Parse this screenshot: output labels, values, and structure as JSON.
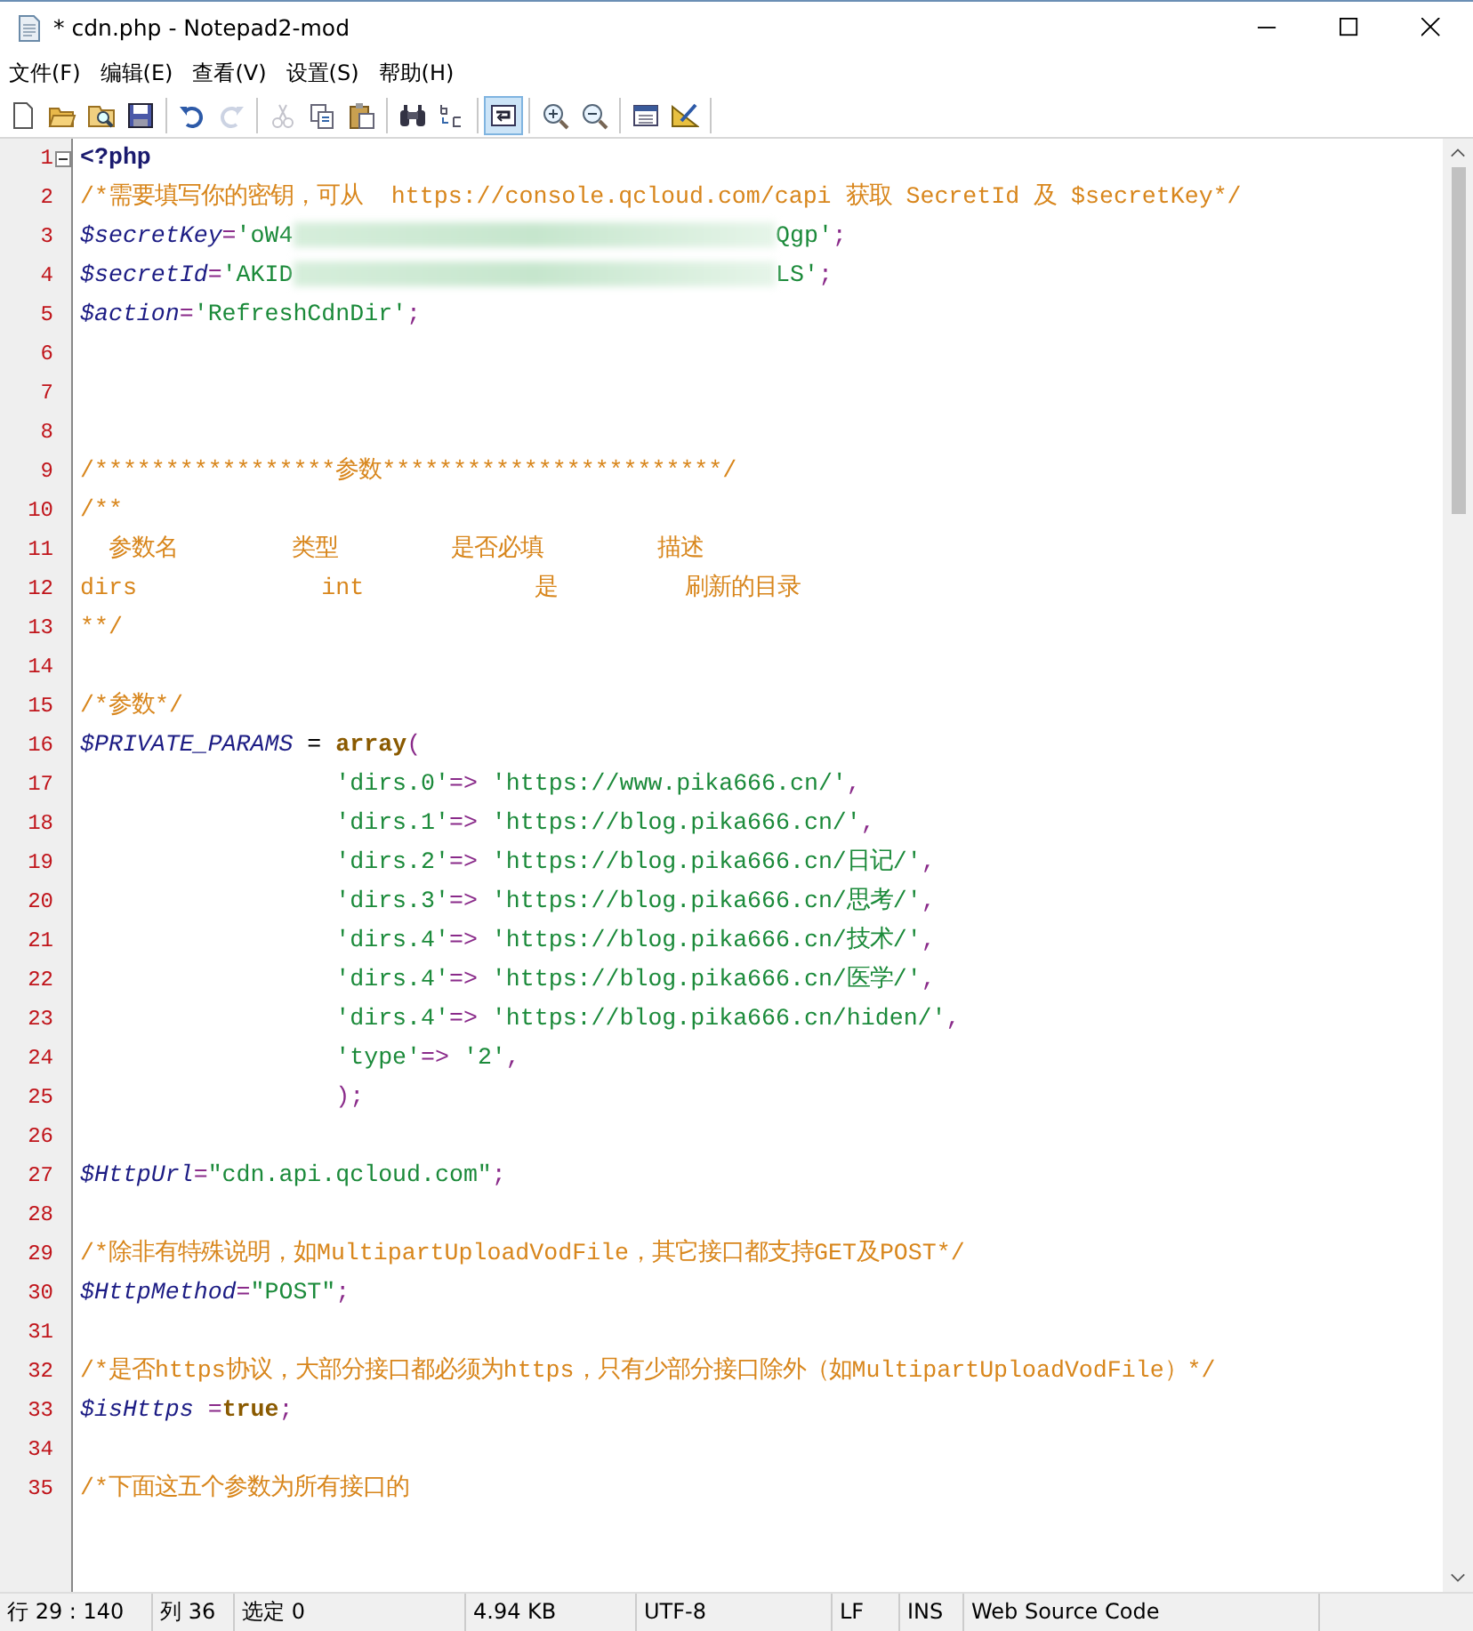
{
  "window": {
    "title": "* cdn.php - Notepad2-mod"
  },
  "menu": [
    "文件(F)",
    "编辑(E)",
    "查看(V)",
    "设置(S)",
    "帮助(H)"
  ],
  "toolbar": [
    {
      "kind": "new",
      "disabled": false,
      "pressed": false
    },
    {
      "kind": "open",
      "disabled": false,
      "pressed": false
    },
    {
      "kind": "browse",
      "disabled": false,
      "pressed": false
    },
    {
      "kind": "save",
      "disabled": false,
      "pressed": false
    },
    {
      "kind": "sep"
    },
    {
      "kind": "undo",
      "disabled": false,
      "pressed": false
    },
    {
      "kind": "redo",
      "disabled": true,
      "pressed": false
    },
    {
      "kind": "sep"
    },
    {
      "kind": "cut",
      "disabled": true,
      "pressed": false
    },
    {
      "kind": "copy",
      "disabled": false,
      "pressed": false
    },
    {
      "kind": "paste",
      "disabled": false,
      "pressed": false
    },
    {
      "kind": "sep"
    },
    {
      "kind": "find",
      "disabled": false,
      "pressed": false
    },
    {
      "kind": "replace",
      "disabled": false,
      "pressed": false
    },
    {
      "kind": "sep"
    },
    {
      "kind": "wrap",
      "disabled": false,
      "pressed": true
    },
    {
      "kind": "sep"
    },
    {
      "kind": "zoomin",
      "disabled": false,
      "pressed": false
    },
    {
      "kind": "zoomout",
      "disabled": false,
      "pressed": false
    },
    {
      "kind": "sep"
    },
    {
      "kind": "scheme",
      "disabled": false,
      "pressed": false
    },
    {
      "kind": "customize",
      "disabled": false,
      "pressed": false
    },
    {
      "kind": "sep"
    }
  ],
  "lines": [
    {
      "number": "1",
      "kind": "code",
      "fold": true,
      "segments": [
        {
          "kind": "tag",
          "text": "<?php"
        }
      ]
    },
    {
      "number": "2",
      "kind": "code",
      "fold": false,
      "segments": [
        {
          "kind": "comment",
          "text": "/*需要填写你的密钥，可从  https://console.qcloud.com/capi 获取 SecretId 及 $secretKey*/"
        }
      ]
    },
    {
      "number": "3",
      "kind": "code",
      "fold": false,
      "segments": [
        {
          "kind": "var",
          "text": "$secretKey"
        },
        {
          "kind": "op",
          "text": "="
        },
        {
          "kind": "str",
          "text": "'oW4"
        },
        {
          "kind": "blur"
        },
        {
          "kind": "str",
          "text": "Qgp'"
        },
        {
          "kind": "op",
          "text": ";"
        }
      ]
    },
    {
      "number": "4",
      "kind": "code",
      "fold": false,
      "segments": [
        {
          "kind": "var",
          "text": "$secretId"
        },
        {
          "kind": "op",
          "text": "="
        },
        {
          "kind": "str",
          "text": "'AKID"
        },
        {
          "kind": "blur"
        },
        {
          "kind": "str",
          "text": "LS'"
        },
        {
          "kind": "op",
          "text": ";"
        }
      ]
    },
    {
      "number": "5",
      "kind": "code",
      "fold": false,
      "segments": [
        {
          "kind": "var",
          "text": "$action"
        },
        {
          "kind": "op",
          "text": "="
        },
        {
          "kind": "str",
          "text": "'RefreshCdnDir'"
        },
        {
          "kind": "op",
          "text": ";"
        }
      ]
    },
    {
      "number": "6",
      "kind": "code",
      "fold": false
    },
    {
      "number": "7",
      "kind": "code",
      "fold": false
    },
    {
      "number": "8",
      "kind": "code",
      "fold": false
    },
    {
      "number": "9",
      "kind": "code",
      "fold": false,
      "segments": [
        {
          "kind": "comment",
          "text": "/*****************参数************************/"
        }
      ]
    },
    {
      "number": "10",
      "kind": "code",
      "fold": false,
      "segments": [
        {
          "kind": "comment",
          "text": "/**"
        }
      ]
    },
    {
      "number": "11",
      "kind": "code",
      "fold": false,
      "segments": [
        {
          "kind": "comment",
          "text": "  参数名        类型        是否必填        描述"
        }
      ]
    },
    {
      "number": "12",
      "kind": "code",
      "fold": false,
      "segments": [
        {
          "kind": "comment",
          "text": "dirs             int            是         刷新的目录"
        }
      ]
    },
    {
      "number": "13",
      "kind": "code",
      "fold": false,
      "segments": [
        {
          "kind": "comment",
          "text": "**/"
        }
      ]
    },
    {
      "number": "14",
      "kind": "code",
      "fold": false
    },
    {
      "number": "15",
      "kind": "code",
      "fold": false,
      "segments": [
        {
          "kind": "comment",
          "text": "/*参数*/"
        }
      ]
    },
    {
      "number": "16",
      "kind": "code",
      "fold": false,
      "segments": [
        {
          "kind": "var",
          "text": "$PRIVATE_PARAMS"
        },
        {
          "kind": "plain",
          "text": " = "
        },
        {
          "kind": "kw",
          "text": "array"
        },
        {
          "kind": "op",
          "text": "("
        }
      ]
    },
    {
      "number": "17",
      "kind": "continuation",
      "fold": false,
      "segments": [
        {
          "kind": "str",
          "text": "'dirs.0'"
        },
        {
          "kind": "op",
          "text": "=> "
        },
        {
          "kind": "str",
          "text": "'https://www.pika666.cn/'"
        },
        {
          "kind": "op",
          "text": ","
        }
      ]
    },
    {
      "number": "18",
      "kind": "continuation",
      "fold": false,
      "segments": [
        {
          "kind": "str",
          "text": "'dirs.1'"
        },
        {
          "kind": "op",
          "text": "=> "
        },
        {
          "kind": "str",
          "text": "'https://blog.pika666.cn/'"
        },
        {
          "kind": "op",
          "text": ","
        }
      ]
    },
    {
      "number": "19",
      "kind": "continuation",
      "fold": false,
      "segments": [
        {
          "kind": "str",
          "text": "'dirs.2'"
        },
        {
          "kind": "op",
          "text": "=> "
        },
        {
          "kind": "str",
          "text": "'https://blog.pika666.cn/日记/'"
        },
        {
          "kind": "op",
          "text": ","
        }
      ]
    },
    {
      "number": "20",
      "kind": "continuation",
      "fold": false,
      "segments": [
        {
          "kind": "str",
          "text": "'dirs.3'"
        },
        {
          "kind": "op",
          "text": "=> "
        },
        {
          "kind": "str",
          "text": "'https://blog.pika666.cn/思考/'"
        },
        {
          "kind": "op",
          "text": ","
        }
      ]
    },
    {
      "number": "21",
      "kind": "continuation",
      "fold": false,
      "segments": [
        {
          "kind": "str",
          "text": "'dirs.4'"
        },
        {
          "kind": "op",
          "text": "=> "
        },
        {
          "kind": "str",
          "text": "'https://blog.pika666.cn/技术/'"
        },
        {
          "kind": "op",
          "text": ","
        }
      ]
    },
    {
      "number": "22",
      "kind": "continuation",
      "fold": false,
      "segments": [
        {
          "kind": "str",
          "text": "'dirs.4'"
        },
        {
          "kind": "op",
          "text": "=> "
        },
        {
          "kind": "str",
          "text": "'https://blog.pika666.cn/医学/'"
        },
        {
          "kind": "op",
          "text": ","
        }
      ]
    },
    {
      "number": "23",
      "kind": "continuation",
      "fold": false,
      "segments": [
        {
          "kind": "str",
          "text": "'dirs.4'"
        },
        {
          "kind": "op",
          "text": "=> "
        },
        {
          "kind": "str",
          "text": "'https://blog.pika666.cn/hiden/'"
        },
        {
          "kind": "op",
          "text": ","
        }
      ]
    },
    {
      "number": "24",
      "kind": "continuation",
      "fold": false,
      "segments": [
        {
          "kind": "str",
          "text": "'type'"
        },
        {
          "kind": "op",
          "text": "=> "
        },
        {
          "kind": "str",
          "text": "'2'"
        },
        {
          "kind": "op",
          "text": ","
        }
      ]
    },
    {
      "number": "25",
      "kind": "continuation",
      "fold": false,
      "segments": [
        {
          "kind": "op",
          "text": ");"
        }
      ]
    },
    {
      "number": "26",
      "kind": "code",
      "fold": false
    },
    {
      "number": "27",
      "kind": "code",
      "fold": false,
      "segments": [
        {
          "kind": "var",
          "text": "$HttpUrl"
        },
        {
          "kind": "op",
          "text": "="
        },
        {
          "kind": "str",
          "text": "\"cdn.api.qcloud.com\""
        },
        {
          "kind": "op",
          "text": ";"
        }
      ]
    },
    {
      "number": "28",
      "kind": "code",
      "fold": false
    },
    {
      "number": "29",
      "kind": "code",
      "fold": false,
      "segments": [
        {
          "kind": "comment",
          "text": "/*除非有特殊说明，如MultipartUploadVodFile，其它接口都支持GET及POST*/"
        }
      ]
    },
    {
      "number": "30",
      "kind": "code",
      "fold": false,
      "segments": [
        {
          "kind": "var",
          "text": "$HttpMethod"
        },
        {
          "kind": "op",
          "text": "="
        },
        {
          "kind": "str",
          "text": "\"POST\""
        },
        {
          "kind": "op",
          "text": ";"
        }
      ]
    },
    {
      "number": "31",
      "kind": "code",
      "fold": false
    },
    {
      "number": "32",
      "kind": "code",
      "fold": false,
      "segments": [
        {
          "kind": "comment",
          "text": "/*是否https协议，大部分接口都必须为https，只有少部分接口除外（如MultipartUploadVodFile）*/"
        }
      ]
    },
    {
      "number": "33",
      "kind": "code",
      "fold": false,
      "segments": [
        {
          "kind": "var",
          "text": "$isHttps"
        },
        {
          "kind": "op",
          "text": " ="
        },
        {
          "kind": "kw",
          "text": "true"
        },
        {
          "kind": "op",
          "text": ";"
        }
      ]
    },
    {
      "number": "34",
      "kind": "code",
      "fold": false
    },
    {
      "number": "35",
      "kind": "code",
      "fold": false,
      "segments": [
        {
          "kind": "comment",
          "text": "/*下面这五个参数为所有接口的"
        }
      ]
    }
  ],
  "status_bar": [
    "行 29 : 140",
    "列 36",
    "选定 0",
    "4.94 KB",
    "UTF-8",
    "LF",
    "INS",
    "Web Source Code"
  ]
}
